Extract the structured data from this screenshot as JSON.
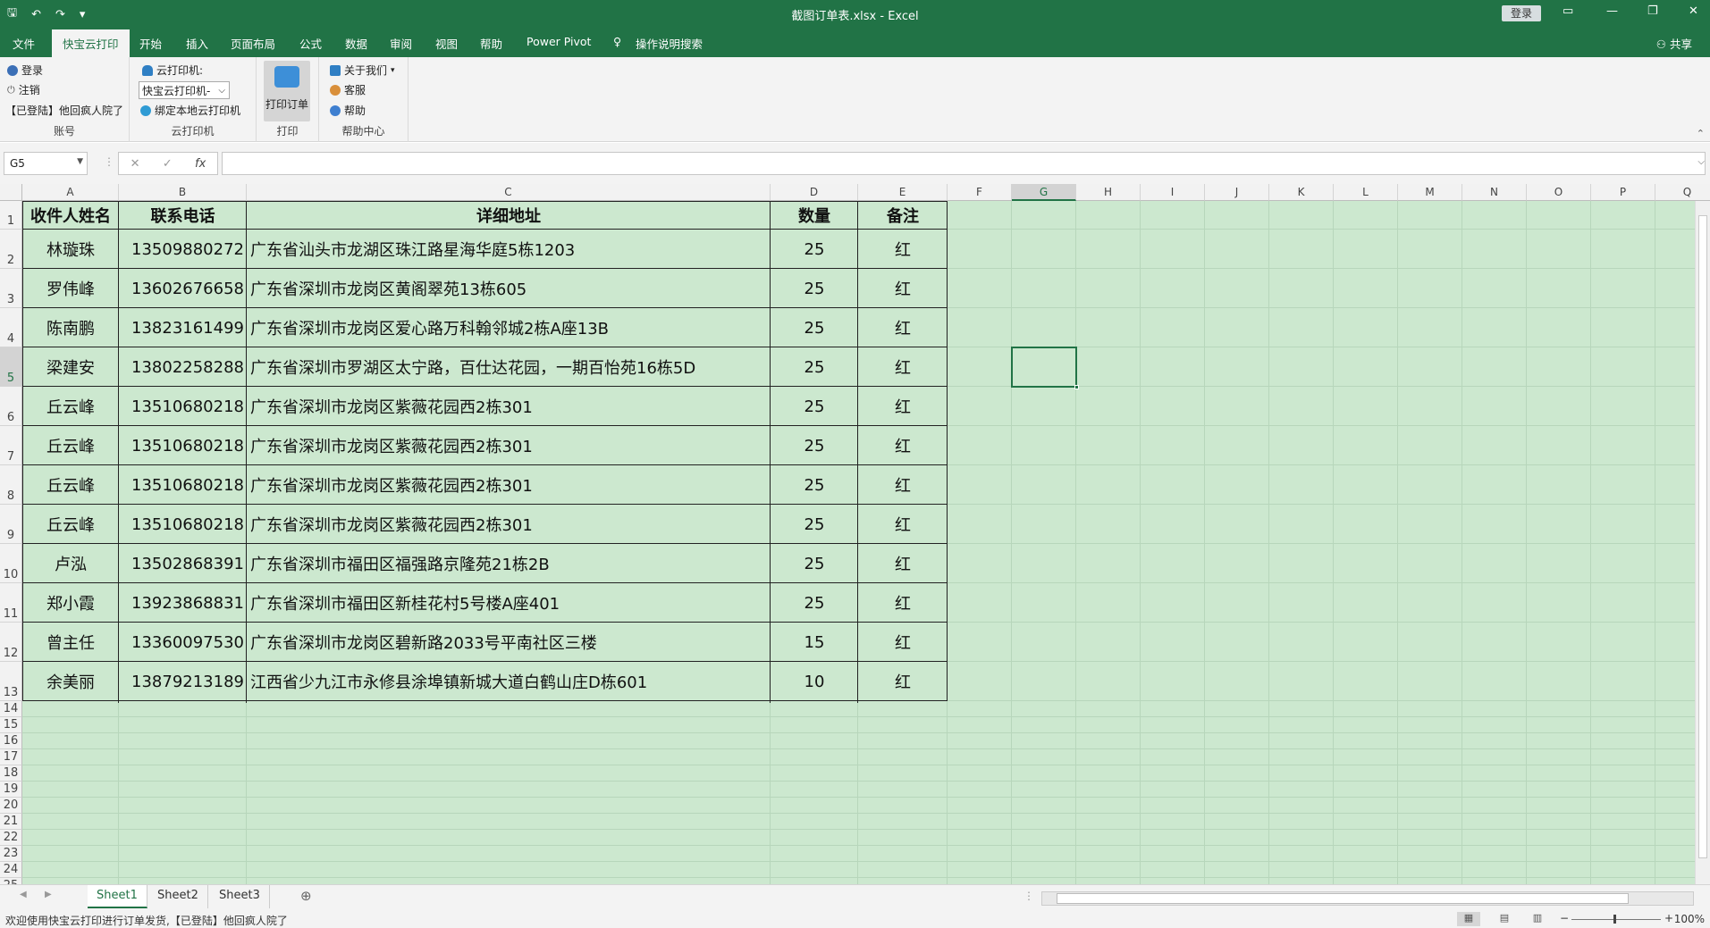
{
  "window": {
    "title": "截图订单表.xlsx  -  Excel",
    "signin": "登录",
    "qat": {
      "save": "save-icon",
      "undo": "undo-icon",
      "redo": "redo-icon"
    }
  },
  "tabs": [
    "文件",
    "快宝云打印",
    "开始",
    "插入",
    "页面布局",
    "公式",
    "数据",
    "审阅",
    "视图",
    "帮助",
    "Power Pivot",
    "操作说明搜索"
  ],
  "share": "共享",
  "ribbon": {
    "account": {
      "login": "登录",
      "logout": "注销",
      "status": "【已登陆】他回疯人院了",
      "label": "账号"
    },
    "printer": {
      "title": "云打印机:",
      "select": "快宝云打印机-",
      "bind": "绑定本地云打印机",
      "label": "云打印机"
    },
    "print": {
      "button": "打印订单",
      "label": "打印"
    },
    "help": {
      "about": "关于我们",
      "service": "客服",
      "help": "帮助",
      "label": "帮助中心"
    }
  },
  "formula": {
    "namebox": "G5",
    "value": ""
  },
  "columns": [
    "A",
    "B",
    "C",
    "D",
    "E",
    "F",
    "G",
    "H",
    "I",
    "J",
    "K",
    "L",
    "M",
    "N",
    "O",
    "P",
    "Q"
  ],
  "rows": [
    "1",
    "2",
    "3",
    "4",
    "5",
    "6",
    "7",
    "8",
    "9",
    "10",
    "11",
    "12",
    "13",
    "14",
    "15",
    "16",
    "17",
    "18",
    "19",
    "20",
    "21",
    "22",
    "23",
    "24",
    "25"
  ],
  "table": {
    "headers": [
      "收件人姓名",
      "联系电话",
      "详细地址",
      "数量",
      "备注"
    ],
    "data": [
      [
        "林璇珠",
        "13509880272",
        "广东省汕头市龙湖区珠江路星海华庭5栋1203",
        "25",
        "红"
      ],
      [
        "罗伟峰",
        "13602676658",
        "广东省深圳市龙岗区黄阁翠苑13栋605",
        "25",
        "红"
      ],
      [
        "陈南鹏",
        "13823161499",
        "广东省深圳市龙岗区爱心路万科翰邻城2栋A座13B",
        "25",
        "红"
      ],
      [
        "梁建安",
        "13802258288",
        "广东省深圳市罗湖区太宁路，百仕达花园，一期百怡苑16栋5D",
        "25",
        "红"
      ],
      [
        "丘云峰",
        "13510680218",
        "广东省深圳市龙岗区紫薇花园西2栋301",
        "25",
        "红"
      ],
      [
        "丘云峰",
        "13510680218",
        "广东省深圳市龙岗区紫薇花园西2栋301",
        "25",
        "红"
      ],
      [
        "丘云峰",
        "13510680218",
        "广东省深圳市龙岗区紫薇花园西2栋301",
        "25",
        "红"
      ],
      [
        "丘云峰",
        "13510680218",
        "广东省深圳市龙岗区紫薇花园西2栋301",
        "25",
        "红"
      ],
      [
        "卢泓",
        "13502868391",
        "广东省深圳市福田区福强路京隆苑21栋2B",
        "25",
        "红"
      ],
      [
        "郑小霞",
        "13923868831",
        "广东省深圳市福田区新桂花村5号楼A座401",
        "25",
        "红"
      ],
      [
        "曾主任",
        "13360097530",
        "广东省深圳市龙岗区碧新路2033号平南社区三楼",
        "15",
        "红"
      ],
      [
        "余美丽",
        "13879213189",
        "江西省少九江市永修县涂埠镇新城大道白鹤山庄D栋601",
        "10",
        "红"
      ]
    ]
  },
  "sheets": [
    "Sheet1",
    "Sheet2",
    "Sheet3"
  ],
  "status": {
    "message": "欢迎使用快宝云打印进行订单发货,【已登陆】他回疯人院了",
    "zoom": "100%"
  }
}
